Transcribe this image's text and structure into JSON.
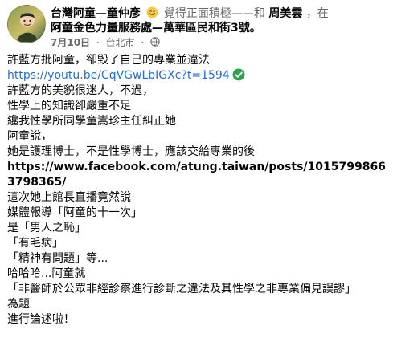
{
  "post": {
    "author": {
      "name": "台灣阿童—童仲彥",
      "avatar_icon": "profile-photo-icon"
    },
    "feeling": {
      "emoji": "smiling-emoji",
      "text": "覺得正面積極——和"
    },
    "mention": {
      "name": "周美雲",
      "after": "，在"
    },
    "location": "阿童金色力量服務處—萬華區民和街3號。",
    "meta": {
      "date": "7月10日",
      "sep": "·",
      "city": "台北市",
      "privacy_icon": "globe-icon"
    },
    "body": {
      "lines": [
        "許藍方批阿童，卻毀了自己的專業並違法",
        "https://youtu.be/CqVGwLbIGXc?t=1594",
        "許藍方的美貌很迷人，不過，",
        "性學上的知識卻嚴重不足",
        "纔我性學所同學童嵩珍主任糾正她",
        "阿童說，",
        "她是護理博士，不是性學博士，應該交給專業的後",
        "https://www.facebook.com/atung.taiwan/posts/10157998663798365/",
        "這次她上館長直播竟然說",
        "媒體報導「阿童的十一次」",
        "是「男人之恥」",
        "「有毛病」",
        "「精神有問題」等...",
        "哈哈哈...阿童就",
        "「非醫師於公眾非經診察進行診斷之違法及其性學之非專業偏見誤謬」",
        "為題",
        "進行論述啦！"
      ],
      "verified_icon": "checkmark-icon"
    }
  }
}
